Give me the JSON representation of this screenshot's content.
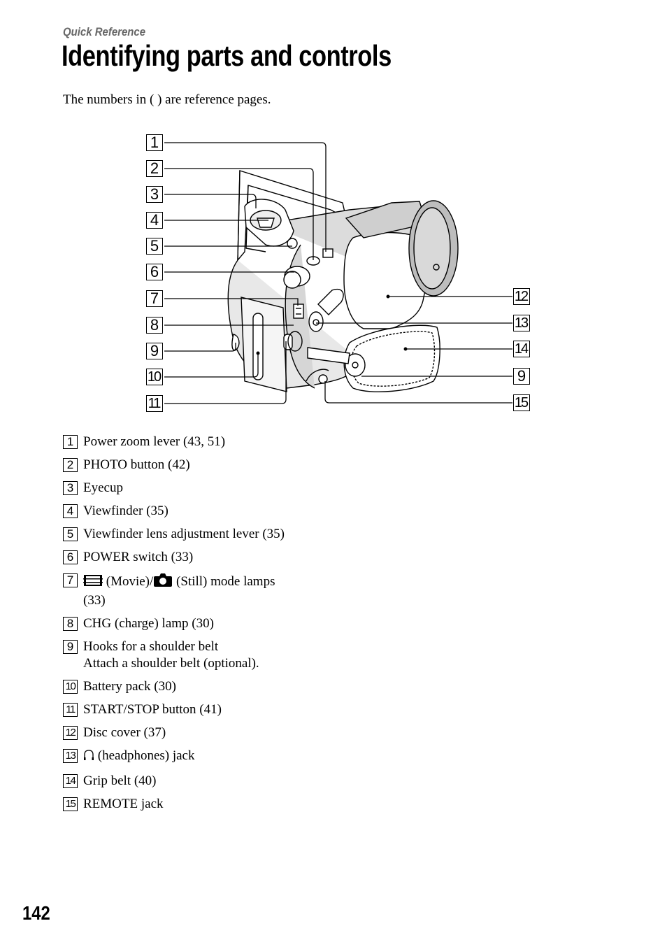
{
  "header": {
    "section": "Quick Reference",
    "title": "Identifying parts and controls",
    "intro": "The numbers in ( ) are reference pages."
  },
  "figure": {
    "subject": "camcorder-illustration",
    "callouts_left": [
      "1",
      "2",
      "3",
      "4",
      "5",
      "6",
      "7",
      "8",
      "9",
      "10",
      "11"
    ],
    "callouts_right": [
      "12",
      "13",
      "14",
      "9",
      "15"
    ]
  },
  "legend": [
    {
      "num": "1",
      "text": "Power zoom lever (43, 51)"
    },
    {
      "num": "2",
      "text": "PHOTO button (42)"
    },
    {
      "num": "3",
      "text": "Eyecup"
    },
    {
      "num": "4",
      "text": "Viewfinder (35)"
    },
    {
      "num": "5",
      "text": "Viewfinder lens adjustment lever (35)"
    },
    {
      "num": "6",
      "text": "POWER switch (33)"
    },
    {
      "num": "7",
      "movie_label": "(Movie)/",
      "still_label": "(Still) mode lamps",
      "second_line": "(33)",
      "icons": [
        "movie-film-icon",
        "camera-still-icon"
      ]
    },
    {
      "num": "8",
      "text": "CHG (charge) lamp (30)"
    },
    {
      "num": "9",
      "text": "Hooks for a shoulder belt",
      "second_line": "Attach a shoulder belt (optional)."
    },
    {
      "num": "10",
      "text": "Battery pack (30)"
    },
    {
      "num": "11",
      "text": "START/STOP button (41)"
    },
    {
      "num": "12",
      "text": "Disc cover (37)"
    },
    {
      "num": "13",
      "text": "(headphones) jack",
      "icon": "headphones-icon"
    },
    {
      "num": "14",
      "text": "Grip belt (40)"
    },
    {
      "num": "15",
      "text": "REMOTE jack"
    }
  ],
  "footer": {
    "page_number": "142"
  }
}
